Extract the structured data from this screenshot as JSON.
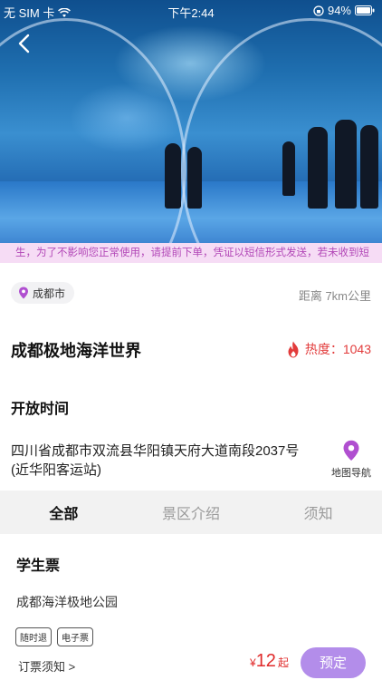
{
  "status_bar": {
    "carrier": "无 SIM 卡",
    "time": "下午2:44",
    "battery": "94%"
  },
  "notice": "生，为了不影响您正常使用，请提前下单，凭证以短信形式发送，若未收到短",
  "location": {
    "city": "成都市",
    "distance": "距离 7km公里"
  },
  "attraction": {
    "name": "成都极地海洋世界",
    "heat_label": "热度：1043"
  },
  "open_time_label": "开放时间",
  "address": "四川省成都市双流县华阳镇天府大道南段2037号 (近华阳客运站)",
  "nav_label": "地图导航",
  "tabs": [
    {
      "label": "全部",
      "active": true
    },
    {
      "label": "景区介绍",
      "active": false
    },
    {
      "label": "须知",
      "active": false
    }
  ],
  "ticket": {
    "section_title": "学生票",
    "product_name": "成都海洋极地公园",
    "tags": [
      "随时退",
      "电子票"
    ],
    "booking_note": "订票须知 >",
    "currency": "¥",
    "price": "12",
    "price_suffix": "起",
    "book_label": "预定"
  },
  "colors": {
    "accent": "#b38dea",
    "price": "#e02b2b",
    "notice_bg": "#f6dcf5",
    "notice_text": "#b247b7"
  }
}
